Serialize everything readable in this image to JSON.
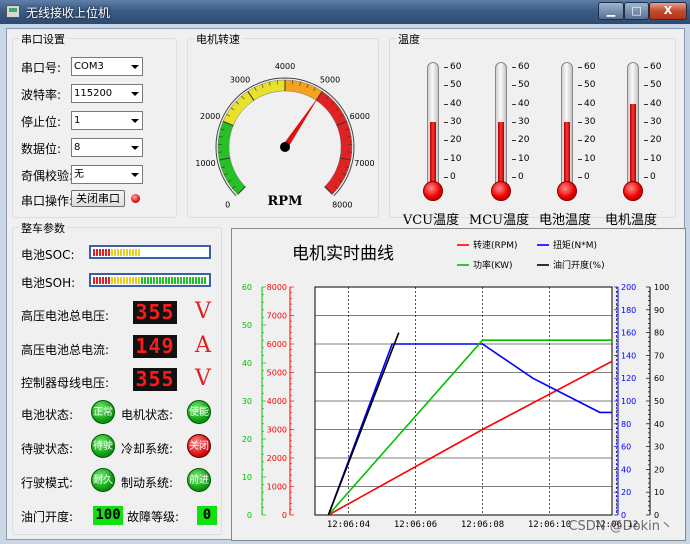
{
  "window": {
    "title": "无线接收上位机",
    "min_label": "▁",
    "max_label": "□",
    "close_label": "X"
  },
  "serial": {
    "group_title": "串口设置",
    "port_label": "串口号:",
    "port_value": "COM3",
    "baud_label": "波特率:",
    "baud_value": "115200",
    "stop_label": "停止位:",
    "stop_value": "1",
    "data_label": "数据位:",
    "data_value": "8",
    "parity_label": "奇偶校验:",
    "parity_value": "无",
    "op_label": "串口操作:",
    "op_button": "关闭串口"
  },
  "speed": {
    "group_title": "电机转速",
    "unit": "RPM",
    "ticks": [
      "0",
      "1000",
      "2000",
      "3000",
      "4000",
      "5000",
      "6000",
      "7000",
      "8000"
    ],
    "max": 8000,
    "value": 5000
  },
  "temperature": {
    "group_title": "温度",
    "ticks": [
      "0",
      "10",
      "20",
      "30",
      "40",
      "50",
      "60"
    ],
    "items": [
      {
        "label": "VCU温度",
        "value": 30
      },
      {
        "label": "MCU温度",
        "value": 30
      },
      {
        "label": "电池温度",
        "value": 30
      },
      {
        "label": "电机温度",
        "value": 40
      }
    ]
  },
  "vehicle": {
    "group_title": "整车参数",
    "soc_label": "电池SOC:",
    "soh_label": "电池SOH:",
    "soc_level": 0.42,
    "soh_level": 1.0,
    "hv_voltage_label": "高压电池总电压:",
    "hv_voltage_value": "355",
    "hv_voltage_unit": "V",
    "hv_current_label": "高压电池总电流:",
    "hv_current_value": "149",
    "hv_current_unit": "A",
    "bus_voltage_label": "控制器母线电压:",
    "bus_voltage_value": "355",
    "bus_voltage_unit": "V",
    "battery_state_label": "电池状态:",
    "battery_state": "正常",
    "motor_state_label": "电机状态:",
    "motor_state": "使能",
    "standby_state_label": "待驶状态:",
    "standby_state": "待驶",
    "cooling_label": "冷却系统:",
    "cooling_state": "关闭",
    "drive_mode_label": "行驶模式:",
    "drive_mode": "耐久",
    "brake_label": "制动系统:",
    "brake_state": "前进",
    "throttle_label": "油门开度:",
    "throttle_value": "100",
    "fault_label": "故障等级:",
    "fault_value": "0"
  },
  "colors": {
    "rpm": "#ff0000",
    "torque": "#0000ff",
    "power": "#00c000",
    "throttle": "#000000"
  },
  "chart_data": {
    "type": "line",
    "title": "电机实时曲线",
    "x": [
      "12:06:04",
      "12:06:06",
      "12:06:08",
      "12:06:10",
      "12:06:12"
    ],
    "x_range": [
      "12:06:03",
      "12:06:12"
    ],
    "series": [
      {
        "name": "转速(RPM)",
        "axis": "rpm",
        "x": [
          "12:06:03.4",
          "12:06:08.0",
          "12:06:12.2",
          "12:06:13.2"
        ],
        "values": [
          0,
          3000,
          5600,
          5600
        ]
      },
      {
        "name": "扭矩(N*M)",
        "axis": "torque",
        "x": [
          "12:06:03.4",
          "12:06:05.3",
          "12:06:08.0",
          "12:06:09.5",
          "12:06:11.5",
          "12:06:13.2"
        ],
        "values": [
          0,
          150,
          150,
          120,
          90,
          90
        ]
      },
      {
        "name": "功率(KW)",
        "axis": "power",
        "x": [
          "12:06:03.4",
          "12:06:08.0",
          "12:06:13.2"
        ],
        "values": [
          0,
          46,
          46
        ]
      },
      {
        "name": "油门开度(%)",
        "axis": "throttle",
        "x": [
          "12:06:03.4",
          "12:06:05.5"
        ],
        "values": [
          0,
          80
        ]
      }
    ],
    "axes": {
      "power": {
        "ticks": [
          "0",
          "10",
          "20",
          "30",
          "40",
          "50",
          "60"
        ],
        "range": [
          0,
          60
        ]
      },
      "rpm": {
        "ticks": [
          "0",
          "1000",
          "2000",
          "3000",
          "4000",
          "5000",
          "6000",
          "7000",
          "8000"
        ],
        "range": [
          0,
          8000
        ]
      },
      "torque": {
        "ticks": [
          "0",
          "20",
          "40",
          "60",
          "80",
          "100",
          "120",
          "140",
          "160",
          "180",
          "200"
        ],
        "range": [
          0,
          200
        ]
      },
      "throttle": {
        "ticks": [
          "0",
          "10",
          "20",
          "30",
          "40",
          "50",
          "60",
          "70",
          "80",
          "90",
          "100"
        ],
        "range": [
          0,
          100
        ]
      }
    }
  },
  "watermark": "CSDN @Dokin丶"
}
